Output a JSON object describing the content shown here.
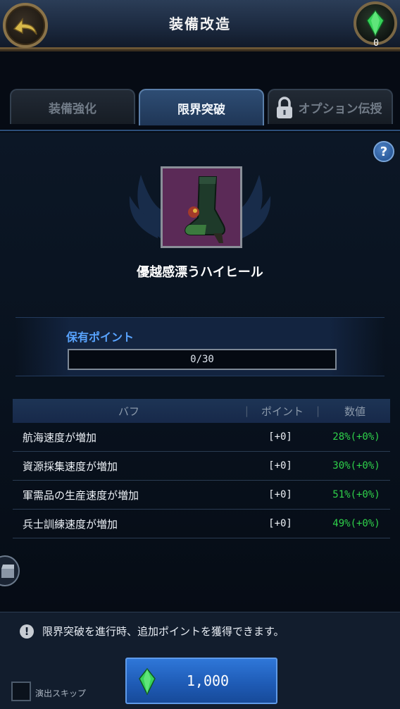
{
  "header": {
    "title": "装備改造",
    "gem_count": "0"
  },
  "tabs": [
    {
      "label": "装備強化",
      "active": false,
      "locked": false
    },
    {
      "label": "限界突破",
      "active": true,
      "locked": false
    },
    {
      "label": "オプション伝授",
      "active": false,
      "locked": true
    }
  ],
  "help_label": "?",
  "item": {
    "name": "優越感漂うハイヒール"
  },
  "points": {
    "label": "保有ポイント",
    "value": "0/30",
    "current": 0,
    "max": 30
  },
  "table": {
    "headers": [
      "バフ",
      "ポイント",
      "数値"
    ],
    "rows": [
      {
        "buff": "航海速度が増加",
        "point": "[+0]",
        "value": "28%(+0%)"
      },
      {
        "buff": "資源採集速度が増加",
        "point": "[+0]",
        "value": "30%(+0%)"
      },
      {
        "buff": "軍需品の生産速度が増加",
        "point": "[+0]",
        "value": "51%(+0%)"
      },
      {
        "buff": "兵士訓練速度が増加",
        "point": "[+0]",
        "value": "49%(+0%)"
      }
    ]
  },
  "footer": {
    "notice": "限界突破を進行時、追加ポイントを獲得できます。",
    "skip_label": "演出スキップ",
    "button_cost": "1,000"
  },
  "colors": {
    "accent": "#2f77d8",
    "value_green": "#2fd24a",
    "points_label": "#59a4ff"
  }
}
